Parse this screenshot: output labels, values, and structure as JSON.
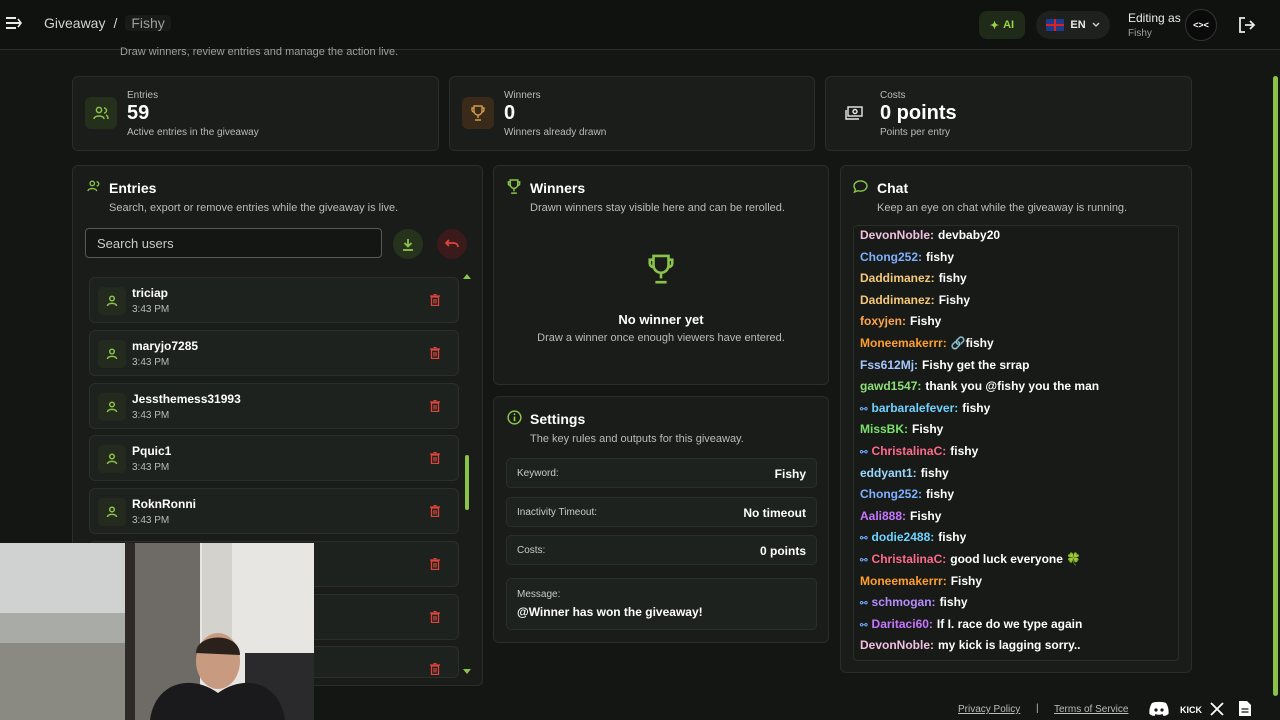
{
  "header": {
    "breadcrumb_root": "Giveaway",
    "breadcrumb_sep": "/",
    "breadcrumb_current": "Fishy",
    "ai_label": "AI",
    "lang_label": "EN",
    "editing_label": "Editing as",
    "editing_user": "Fishy",
    "avatar_text": "<><"
  },
  "subtitle": "Draw winners, review entries and manage the action live.",
  "stats": [
    {
      "label": "Entries",
      "value": "59",
      "desc": "Active entries in the giveaway"
    },
    {
      "label": "Winners",
      "value": "0",
      "desc": "Winners already drawn"
    },
    {
      "label": "Costs",
      "value": "0 points",
      "desc": "Points per entry"
    }
  ],
  "entries_panel": {
    "title": "Entries",
    "subtitle": "Search, export or remove entries while the giveaway is live.",
    "search_placeholder": "Search users",
    "items": [
      {
        "name": "triciap",
        "time": "3:43 PM"
      },
      {
        "name": "maryjo7285",
        "time": "3:43 PM"
      },
      {
        "name": "Jessthemess31993",
        "time": "3:43 PM"
      },
      {
        "name": "Pquic1",
        "time": "3:43 PM"
      },
      {
        "name": "RoknRonni",
        "time": "3:43 PM"
      }
    ]
  },
  "winners_panel": {
    "title": "Winners",
    "subtitle": "Drawn winners stay visible here and can be rerolled.",
    "empty_title": "No winner yet",
    "empty_desc": "Draw a winner once enough viewers have entered."
  },
  "settings_panel": {
    "title": "Settings",
    "subtitle": "The key rules and outputs for this giveaway.",
    "keyword_label": "Keyword:",
    "keyword_value": "Fishy",
    "timeout_label": "Inactivity Timeout:",
    "timeout_value": "No timeout",
    "costs_label": "Costs:",
    "costs_value": "0 points",
    "message_label": "Message:",
    "message_value": "@Winner has won the giveaway!"
  },
  "chat_panel": {
    "title": "Chat",
    "subtitle": "Keep an eye on chat while the giveaway is running.",
    "messages": [
      {
        "user": "DevonNoble:",
        "text": "devbaby20",
        "color": "#f0c0e0",
        "badge": ""
      },
      {
        "user": "Chong252:",
        "text": "fishy",
        "color": "#7fb0ff",
        "badge": ""
      },
      {
        "user": "Daddimanez:",
        "text": "fishy",
        "color": "#f5c97a",
        "badge": ""
      },
      {
        "user": "Daddimanez:",
        "text": "Fishy",
        "color": "#f5c97a",
        "badge": ""
      },
      {
        "user": "foxyjen:",
        "text": "Fishy",
        "color": "#ffa64d",
        "badge": ""
      },
      {
        "user": "Moneemakerrr:",
        "text": "🔗fishy",
        "color": "#ff9f2e",
        "badge": ""
      },
      {
        "user": "Fss612Mj:",
        "text": "Fishy get the srrap",
        "color": "#a6c8ff",
        "badge": ""
      },
      {
        "user": "gawd1547:",
        "text": "thank you @fishy you the man",
        "color": "#8ee07a",
        "badge": ""
      },
      {
        "user": "barbaralefever:",
        "text": "fishy",
        "color": "#6fd3ff",
        "badge": "⚯"
      },
      {
        "user": "MissBK:",
        "text": "Fishy",
        "color": "#7be06b",
        "badge": ""
      },
      {
        "user": "ChristalinaC:",
        "text": "fishy",
        "color": "#ff6a8a",
        "badge": "⚯"
      },
      {
        "user": "eddyant1:",
        "text": "fishy",
        "color": "#9ad7ff",
        "badge": ""
      },
      {
        "user": "Chong252:",
        "text": "fishy",
        "color": "#7fb0ff",
        "badge": ""
      },
      {
        "user": "Aali888:",
        "text": "Fishy",
        "color": "#c777ff",
        "badge": ""
      },
      {
        "user": "dodie2488:",
        "text": "fishy",
        "color": "#6fd3ff",
        "badge": "⚯"
      },
      {
        "user": "ChristalinaC:",
        "text": "good luck everyone 🍀",
        "color": "#ff6a8a",
        "badge": "⚯"
      },
      {
        "user": "Moneemakerrr:",
        "text": "Fishy",
        "color": "#ff9f2e",
        "badge": ""
      },
      {
        "user": "schmogan:",
        "text": "fishy",
        "color": "#b78cff",
        "badge": "⚯"
      },
      {
        "user": "Daritaci60:",
        "text": "If I. race do we type again",
        "color": "#c777ff",
        "badge": "⚯"
      },
      {
        "user": "DevonNoble:",
        "text": "my kick is lagging sorry..",
        "color": "#f0c0e0",
        "badge": ""
      }
    ]
  },
  "footer": {
    "privacy": "Privacy Policy",
    "sep": "|",
    "terms": "Terms of Service"
  },
  "colors": {
    "accent": "#8bc34a",
    "danger": "#e0443a",
    "bg": "#141614",
    "panel": "#191c19"
  }
}
